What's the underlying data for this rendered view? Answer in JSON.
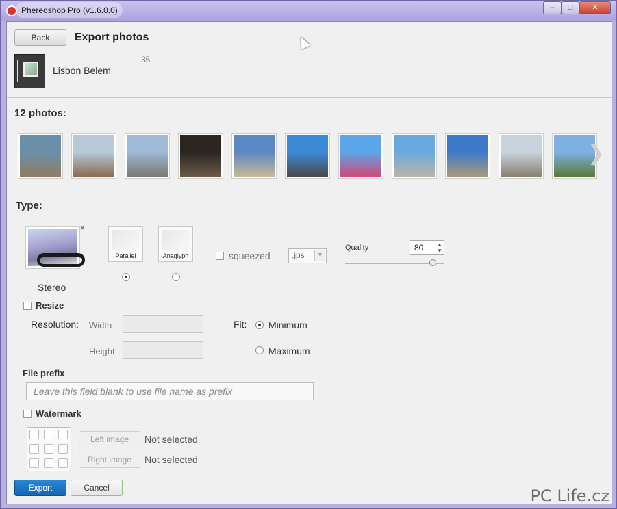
{
  "window": {
    "title": "Phereoshop Pro (v1.6.0.0)",
    "controls": {
      "minimize": "–",
      "maximize": "□",
      "close": "✕"
    }
  },
  "header": {
    "back_label": "Back",
    "title": "Export photos",
    "album_name": "Lisbon Belem",
    "album_count": "35"
  },
  "photos": {
    "heading": "12 photos:",
    "thumbs": [
      {
        "colors": [
          "#6b8fa8",
          "#8e7d62"
        ]
      },
      {
        "colors": [
          "#b8c9d9",
          "#8a6b52"
        ]
      },
      {
        "colors": [
          "#9fb9d6",
          "#7a7a72"
        ]
      },
      {
        "colors": [
          "#2a2520",
          "#6a5a48"
        ]
      },
      {
        "colors": [
          "#5b88c2",
          "#c8b89a"
        ]
      },
      {
        "colors": [
          "#3b8ad6",
          "#4a4a4a"
        ]
      },
      {
        "colors": [
          "#5aa6e8",
          "#d04a7a"
        ]
      },
      {
        "colors": [
          "#6aa9df",
          "#b9b4a8"
        ]
      },
      {
        "colors": [
          "#3d79c9",
          "#a79a7c"
        ]
      },
      {
        "colors": [
          "#c9d3dc",
          "#8a8070"
        ]
      },
      {
        "colors": [
          "#7fb0e2",
          "#5a7a3a"
        ]
      }
    ]
  },
  "type": {
    "heading": "Type:",
    "stereo_label": "Stereo",
    "parallel_label": "Parallel",
    "anaglyph_label": "Anaglyph",
    "squeezed_label": "squeezed",
    "format_value": ".jps",
    "quality_label": "Quality",
    "quality_value": "80",
    "quality_level_percent": 88
  },
  "resize": {
    "label": "Resize",
    "resolution_label": "Resolution:",
    "width_label": "Width",
    "height_label": "Height",
    "fit_label": "Fit:",
    "minimum_label": "Minimum",
    "maximum_label": "Maximum"
  },
  "prefix": {
    "label": "File prefix",
    "placeholder": "Leave this field blank to use file name as prefix"
  },
  "watermark": {
    "label": "Watermark",
    "left_button": "Left image",
    "right_button": "Right image",
    "left_status": "Not selected",
    "right_status": "Not selected"
  },
  "footer": {
    "export_label": "Export",
    "cancel_label": "Cancel",
    "site_watermark": "PC Life.cz"
  }
}
